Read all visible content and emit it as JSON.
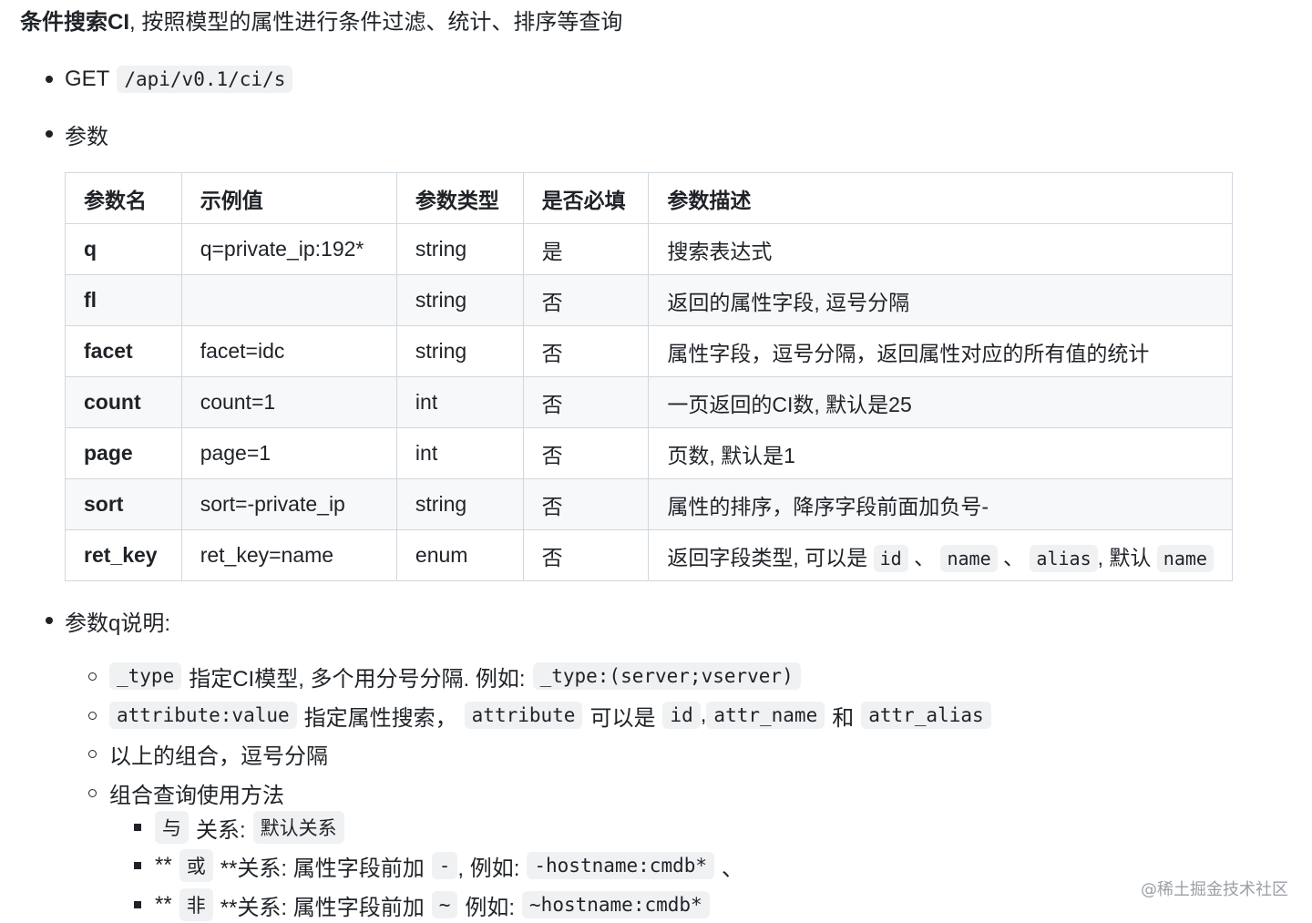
{
  "title": {
    "bold": "条件搜索CI",
    "rest": ", 按照模型的属性进行条件过滤、统计、排序等查询"
  },
  "endpoint": {
    "method": "GET",
    "path": "/api/v0.1/ci/s"
  },
  "params_label": "参数",
  "table": {
    "headers": [
      "参数名",
      "示例值",
      "参数类型",
      "是否必填",
      "参数描述"
    ],
    "rows": [
      {
        "name": "q",
        "example": "q=private_ip:192*",
        "type": "string",
        "required": "是",
        "desc": "搜索表达式"
      },
      {
        "name": "fl",
        "example": "",
        "type": "string",
        "required": "否",
        "desc": "返回的属性字段, 逗号分隔"
      },
      {
        "name": "facet",
        "example": "facet=idc",
        "type": "string",
        "required": "否",
        "desc": "属性字段，逗号分隔，返回属性对应的所有值的统计"
      },
      {
        "name": "count",
        "example": "count=1",
        "type": "int",
        "required": "否",
        "desc": "一页返回的CI数, 默认是25"
      },
      {
        "name": "page",
        "example": "page=1",
        "type": "int",
        "required": "否",
        "desc": "页数, 默认是1"
      },
      {
        "name": "sort",
        "example": "sort=-private_ip",
        "type": "string",
        "required": "否",
        "desc": "属性的排序，降序字段前面加负号-"
      },
      {
        "name": "ret_key",
        "example": "ret_key=name",
        "type": "enum",
        "required": "否",
        "desc_parts": {
          "prefix": "返回字段类型, 可以是",
          "c1": "id",
          "sep1": "、",
          "c2": "name",
          "sep2": "、",
          "c3": "alias",
          "mid": ", 默认",
          "c4": "name"
        }
      }
    ]
  },
  "q_section": {
    "label": "参数q说明:",
    "type_item": {
      "code": "_type",
      "text": "指定CI模型, 多个用分号分隔. 例如:",
      "example": "_type:(server;vserver)"
    },
    "attr_item": {
      "code": "attribute:value",
      "text": "指定属性搜索，",
      "code2": "attribute",
      "text2": "可以是",
      "code3": "id",
      "sep": ",",
      "code4": "attr_name",
      "and": "和",
      "code5": "attr_alias"
    },
    "combo_item": "以上的组合，逗号分隔",
    "usage_item": "组合查询使用方法",
    "and_item": {
      "code": "与",
      "text": "关系:",
      "code2": "默认关系"
    },
    "or_item": {
      "pre": "**",
      "code": "或",
      "text": "**关系: 属性字段前加",
      "code2": "-",
      "text2": ", 例如:",
      "example": "-hostname:cmdb*",
      "tail": "、"
    },
    "not_item": {
      "pre": "**",
      "code": "非",
      "text": "**关系: 属性字段前加",
      "code2": "~",
      "text2": "例如:",
      "example": "~hostname:cmdb*"
    }
  },
  "watermark": "@稀土掘金技术社区"
}
